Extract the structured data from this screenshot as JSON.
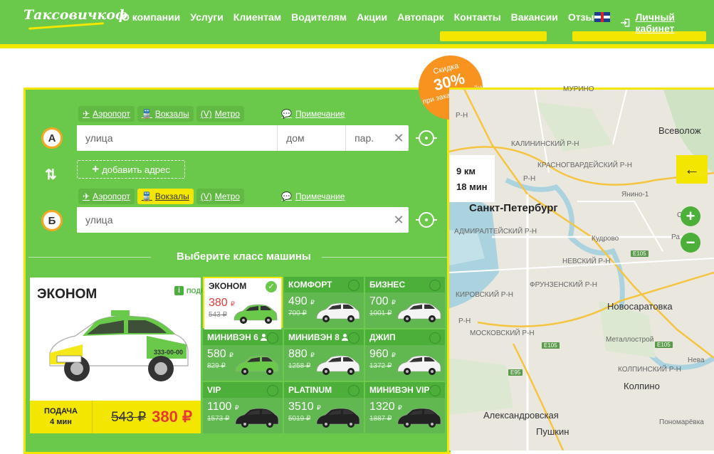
{
  "header": {
    "logo": "Таксовичкоф",
    "nav": [
      "О компании",
      "Услуги",
      "Клиентам",
      "Водителям",
      "Акции",
      "Автопарк",
      "Контакты",
      "Вакансии",
      "Отзывы"
    ],
    "login": "Личный кабинет",
    "flag_icon": "uk-flag-icon",
    "colors": {
      "brand_green": "#6ac94a",
      "brand_yellow": "#f3e600",
      "accent_orange": "#f7931e",
      "price_red": "#e53935"
    }
  },
  "promo": {
    "line1": "Скидка",
    "percent": "30%",
    "line3": "при заказе онлайн"
  },
  "form": {
    "point_a": "А",
    "point_b": "Б",
    "chips": {
      "airport": "Аэропорт",
      "station": "Вокзалы",
      "metro": "Метро",
      "metro_mark": "(V)"
    },
    "note": "Примечание",
    "street_placeholder": "улица",
    "house_placeholder": "дом",
    "entrance_placeholder": "пар.",
    "add_address": "добавить адрес",
    "choose_class": "Выберите класс машины"
  },
  "selected": {
    "name": "ЭКОНОМ",
    "more": "ПОДРОБНЕЕ",
    "pickup_label": "ПОДАЧА",
    "pickup_time": "4 мин",
    "old_price": "543 ₽",
    "new_price": "380 ₽",
    "phone_on_car": "333-00-00"
  },
  "classes": [
    {
      "name": "ЭКОНОМ",
      "price": "380",
      "old": "543 ₽",
      "selected": true,
      "person": false,
      "car": "green"
    },
    {
      "name": "КОМФОРТ",
      "price": "490",
      "old": "700 ₽",
      "selected": false,
      "person": false,
      "car": "white"
    },
    {
      "name": "БИЗНЕС",
      "price": "700",
      "old": "1001 ₽",
      "selected": false,
      "person": false,
      "car": "white"
    },
    {
      "name": "МИНИВЭН 6",
      "price": "580",
      "old": "829 ₽",
      "selected": false,
      "person": true,
      "car": "green"
    },
    {
      "name": "МИНИВЭН 8",
      "price": "880",
      "old": "1258 ₽",
      "selected": false,
      "person": true,
      "car": "white"
    },
    {
      "name": "ДЖИП",
      "price": "960",
      "old": "1372 ₽",
      "selected": false,
      "person": false,
      "car": "white"
    },
    {
      "name": "VIP",
      "price": "1100",
      "old": "1573 ₽",
      "selected": false,
      "person": false,
      "car": "black"
    },
    {
      "name": "PLATINUM",
      "price": "3510",
      "old": "5019 ₽",
      "selected": false,
      "person": false,
      "car": "black"
    },
    {
      "name": "МИНИВЭН VIP",
      "price": "1320",
      "old": "1887 ₽",
      "selected": false,
      "person": false,
      "car": "black"
    }
  ],
  "currency": "₽",
  "map": {
    "distance": "9 км",
    "duration": "18 мин",
    "city": "Санкт-Петербург",
    "labels": [
      "МУРИНО",
      "Р-Н",
      "Всеволож",
      "КАЛИНИНСКИЙ Р-Н",
      "КРАСНОГВАРДЕЙСКИЙ Р-Н",
      "Р-Н",
      "Янино-1",
      "АДМИРАЛТЕЙСКИЙ Р-Н",
      "Кудрово",
      "Стара",
      "Ра",
      "НЕВСКИЙ Р-Н",
      "ФРУНЗЕНСКИЙ Р-Н",
      "КИРОВСКИЙ Р-Н",
      "Новосаратовка",
      "Р-Н",
      "МОСКОВСКИЙ Р-Н",
      "Металлострой",
      "КОЛПИНСКИЙ Р-Н",
      "Колпино",
      "Александровская",
      "Пушкин",
      "Пономарёвка",
      "Нева"
    ],
    "roads": [
      "E105",
      "E105",
      "E105",
      "E95"
    ]
  }
}
